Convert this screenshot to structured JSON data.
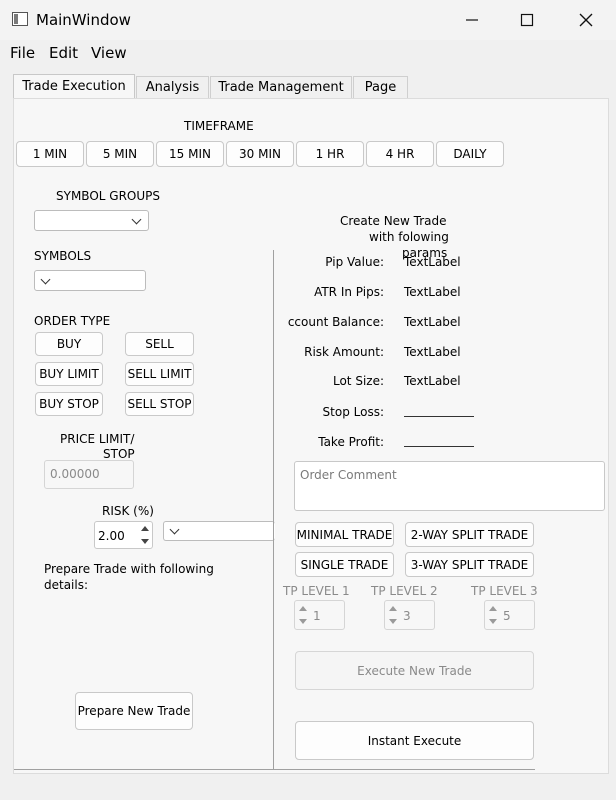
{
  "window": {
    "title": "MainWindow"
  },
  "menu": [
    "File",
    "Edit",
    "View"
  ],
  "tabs": [
    "Trade Execution",
    "Analysis",
    "Trade Management",
    "Page"
  ],
  "timeframe": {
    "label": "TIMEFRAME",
    "buttons": [
      "1 MIN",
      "5 MIN",
      "15 MIN",
      "30 MIN",
      "1 HR",
      "4 HR",
      "DAILY"
    ]
  },
  "left": {
    "symbol_groups_label": "SYMBOL GROUPS",
    "symbols_label": "SYMBOLS",
    "order_type_label": "ORDER TYPE",
    "order_buttons": [
      "BUY",
      "SELL",
      "BUY LIMIT",
      "SELL LIMIT",
      "BUY STOP",
      "SELL STOP"
    ],
    "price_limit_label_1": "PRICE LIMIT/",
    "price_limit_label_2": "STOP",
    "price_placeholder": "0.00000",
    "risk_label": "RISK (%)",
    "risk_value": "2.00",
    "prepare_text_1": "Prepare Trade with following",
    "prepare_text_2": "details:",
    "prepare_button": "Prepare New Trade"
  },
  "right": {
    "header_1": "Create New Trade",
    "header_2": "with folowing",
    "header_3": "params",
    "rows": [
      {
        "label": "Pip Value:",
        "value": "TextLabel"
      },
      {
        "label": "ATR In Pips:",
        "value": "TextLabel"
      },
      {
        "label": "ccount Balance:",
        "value": "TextLabel"
      },
      {
        "label": "Risk Amount:",
        "value": "TextLabel"
      },
      {
        "label": "Lot Size:",
        "value": "TextLabel"
      }
    ],
    "stop_loss_label": "Stop Loss:",
    "take_profit_label": "Take Profit:",
    "order_comment_placeholder": "Order Comment",
    "trade_buttons": [
      "MINIMAL TRADE",
      "2-WAY SPLIT TRADE",
      "SINGLE TRADE",
      "3-WAY SPLIT TRADE"
    ],
    "tp_levels": [
      {
        "label": "TP LEVEL 1",
        "value": "1"
      },
      {
        "label": "TP LEVEL 2",
        "value": "3"
      },
      {
        "label": "TP LEVEL 3",
        "value": "5"
      }
    ],
    "execute_button": "Execute New Trade",
    "instant_button": "Instant Execute"
  }
}
